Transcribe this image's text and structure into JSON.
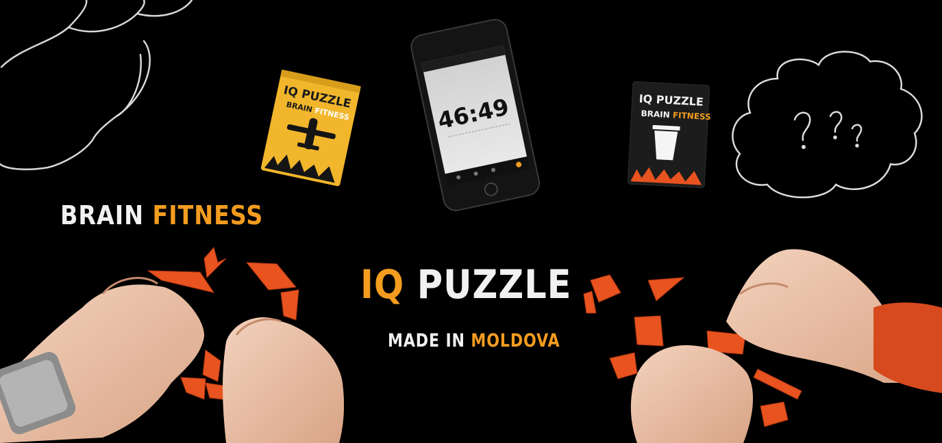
{
  "banner": {
    "tagline_white": "BRAIN",
    "tagline_orange": "FITNESS",
    "brand_orange": "IQ",
    "brand_white": "PUZZLE",
    "origin_white": "MADE IN",
    "origin_orange": "MOLDOVA"
  },
  "box_yellow": {
    "title": "IQ PUZZLE",
    "sub_dark": "BRAIN",
    "sub_white": "FITNESS"
  },
  "box_black": {
    "title": "IQ PUZZLE",
    "sub_white": "BRAIN",
    "sub_orange": "FITNESS"
  },
  "phone": {
    "timer": "46:49"
  },
  "colors": {
    "accent": "#f39c1f",
    "tangram": "#e8531f",
    "box_yellow": "#f1b62b"
  }
}
